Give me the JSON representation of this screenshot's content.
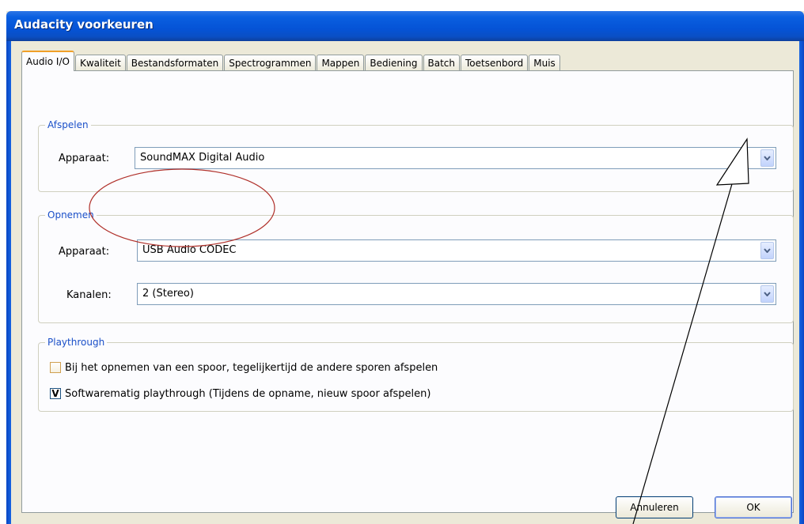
{
  "window": {
    "title": "Audacity voorkeuren"
  },
  "tabs": [
    {
      "label": "Audio I/O",
      "active": true
    },
    {
      "label": "Kwaliteit"
    },
    {
      "label": "Bestandsformaten"
    },
    {
      "label": "Spectrogrammen"
    },
    {
      "label": "Mappen"
    },
    {
      "label": "Bediening"
    },
    {
      "label": "Batch"
    },
    {
      "label": "Toetsenbord"
    },
    {
      "label": "Muis"
    }
  ],
  "playback": {
    "group_label": "Afspelen",
    "device_label": "Apparaat:",
    "device_value": "SoundMAX Digital Audio"
  },
  "recording": {
    "group_label": "Opnemen",
    "device_label": "Apparaat:",
    "device_value": "USB Audio CODEC",
    "channels_label": "Kanalen:",
    "channels_value": "2 (Stereo)"
  },
  "playthrough": {
    "group_label": "Playthrough",
    "option1_label": "Bij het opnemen van een spoor, tegelijkertijd de andere sporen afspelen",
    "option1_checked": false,
    "option2_label": "Softwarematig playthrough (Tijdens de opname, nieuw spoor afspelen)",
    "option2_checked": true,
    "check_mark": "V"
  },
  "buttons": {
    "cancel": "Annuleren",
    "ok": "OK"
  },
  "colors": {
    "titlebar": "#0553d6",
    "group_label": "#1a4fc8",
    "annotation_ellipse": "#b0302a",
    "annotation_arrow": "#000000"
  },
  "annotations": [
    "red-ellipse-around-recording-device",
    "arrow-pointing-to-playback-dropdown"
  ]
}
